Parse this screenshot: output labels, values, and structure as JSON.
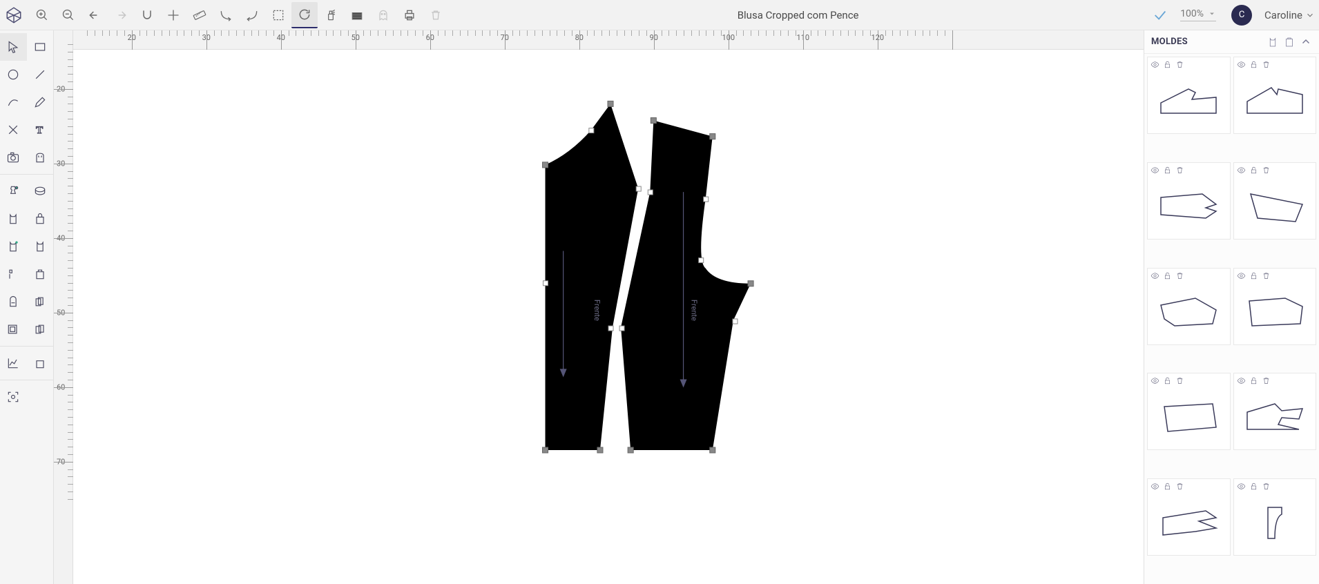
{
  "document_title": "Blusa Cropped com Pence",
  "zoom_text": "100%",
  "user": {
    "initial": "C",
    "name": "Caroline"
  },
  "right_panel": {
    "title": "MOLDES"
  },
  "ruler": {
    "h_labels": [
      "20",
      "30",
      "40",
      "50",
      "60",
      "70",
      "80",
      "90",
      "100",
      "110",
      "120"
    ],
    "v_labels": [
      "20",
      "30",
      "40",
      "50",
      "60",
      "70"
    ]
  },
  "pieces": {
    "left_label": "Frente",
    "right_label": "Frente"
  }
}
